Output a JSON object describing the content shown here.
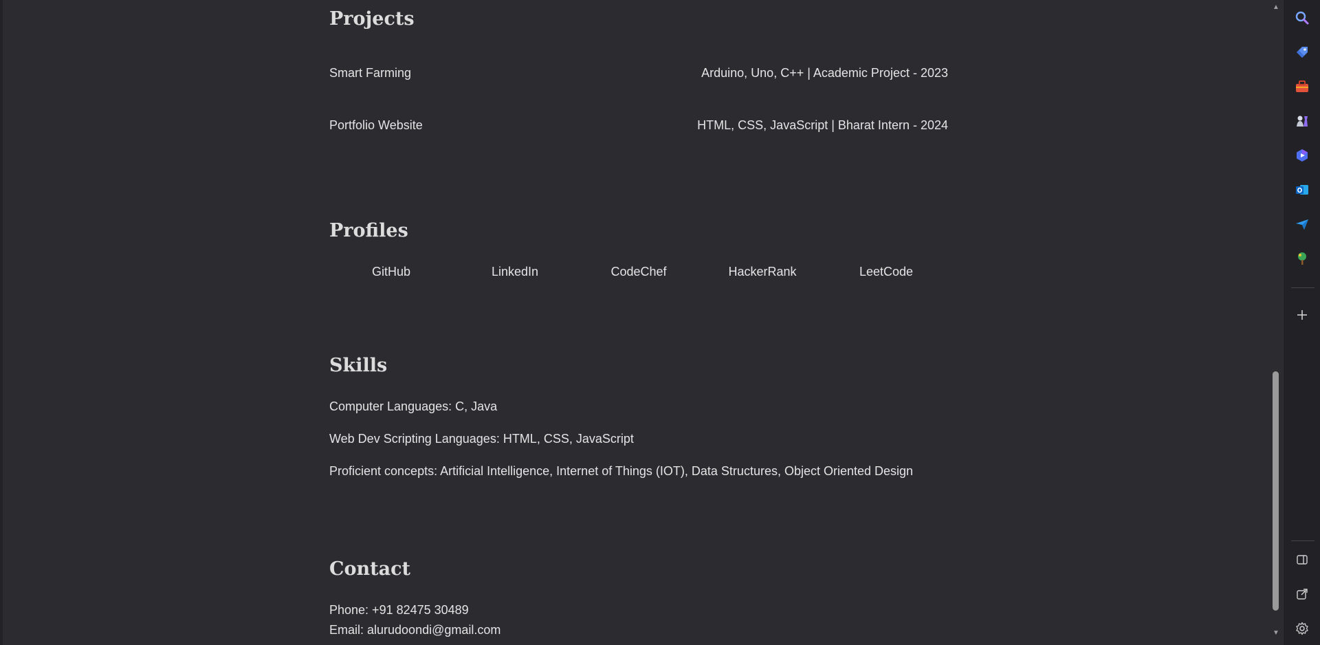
{
  "sections": {
    "projects": {
      "title": "Projects",
      "items": [
        {
          "name": "Smart Farming",
          "details": "Arduino, Uno, C++ | Academic Project - 2023"
        },
        {
          "name": "Portfolio Website",
          "details": "HTML, CSS, JavaScript | Bharat Intern - 2024"
        }
      ]
    },
    "profiles": {
      "title": "Profiles",
      "links": [
        "GitHub",
        "LinkedIn",
        "CodeChef",
        "HackerRank",
        "LeetCode"
      ]
    },
    "skills": {
      "title": "Skills",
      "lines": [
        "Computer Languages: C, Java",
        "Web Dev Scripting Languages: HTML, CSS, JavaScript",
        "Proficient concepts: Artificial Intelligence, Internet of Things (IOT), Data Structures, Object Oriented Design"
      ]
    },
    "contact": {
      "title": "Contact",
      "phone": "Phone: +91 82475 30489",
      "email": "Email: alurudoondi@gmail.com"
    }
  },
  "sidebar": {
    "icons": [
      "search-icon",
      "shopping-tag-icon",
      "tools-briefcase-icon",
      "chess-games-icon",
      "copilot-icon",
      "outlook-icon",
      "send-drop-icon",
      "tree-icon",
      "add-icon",
      "split-screen-icon",
      "external-link-icon",
      "settings-gear-icon"
    ]
  },
  "colors": {
    "background": "#2c2b30",
    "sidebar": "#222125",
    "text": "#e4e4e4"
  }
}
